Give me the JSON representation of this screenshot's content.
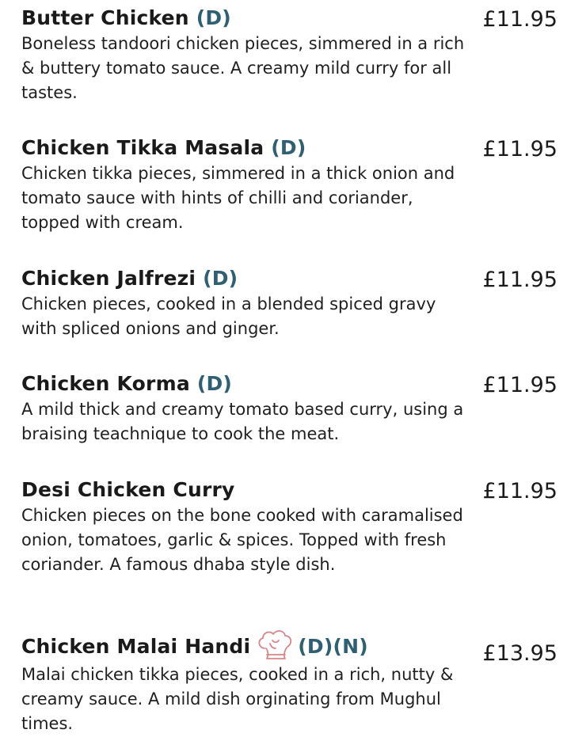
{
  "items": [
    {
      "name": "Butter Chicken",
      "tags": "(D)",
      "price": "£11.95",
      "description": "Boneless tandoori chicken pieces, simmered in a rich & buttery tomato sauce.  A creamy mild curry for all tastes."
    },
    {
      "name": "Chicken Tikka Masala",
      "tags": "(D)",
      "price": "£11.95",
      "description": "Chicken tikka pieces, simmered in a thick onion and tomato sauce with hints of chilli and coriander, topped with cream."
    },
    {
      "name": "Chicken Jalfrezi",
      "tags": "(D)",
      "price": "£11.95",
      "description": "Chicken pieces, cooked in a blended spiced gravy with spliced onions and ginger."
    },
    {
      "name": "Chicken Korma",
      "tags": "(D)",
      "price": "£11.95",
      "description": "A mild thick and creamy tomato based curry, using a braising teachnique to cook the meat."
    },
    {
      "name": "Desi Chicken Curry",
      "tags": "",
      "price": "£11.95",
      "description": "Chicken pieces on the bone cooked with caramalised onion, tomatoes, garlic & spices. Topped with fresh coriander. A famous dhaba style dish."
    },
    {
      "name": "Chicken Malai Handi",
      "tags": "(D)(N)",
      "price": "£13.95",
      "icon": "chef-hat-icon",
      "description": "Malai chicken tikka pieces, cooked in a rich, nutty & creamy sauce. A mild dish orginating from Mughul times."
    }
  ],
  "colors": {
    "text": "#1a1a1a",
    "tag": "#2f5f73",
    "icon": "#d9868a"
  }
}
